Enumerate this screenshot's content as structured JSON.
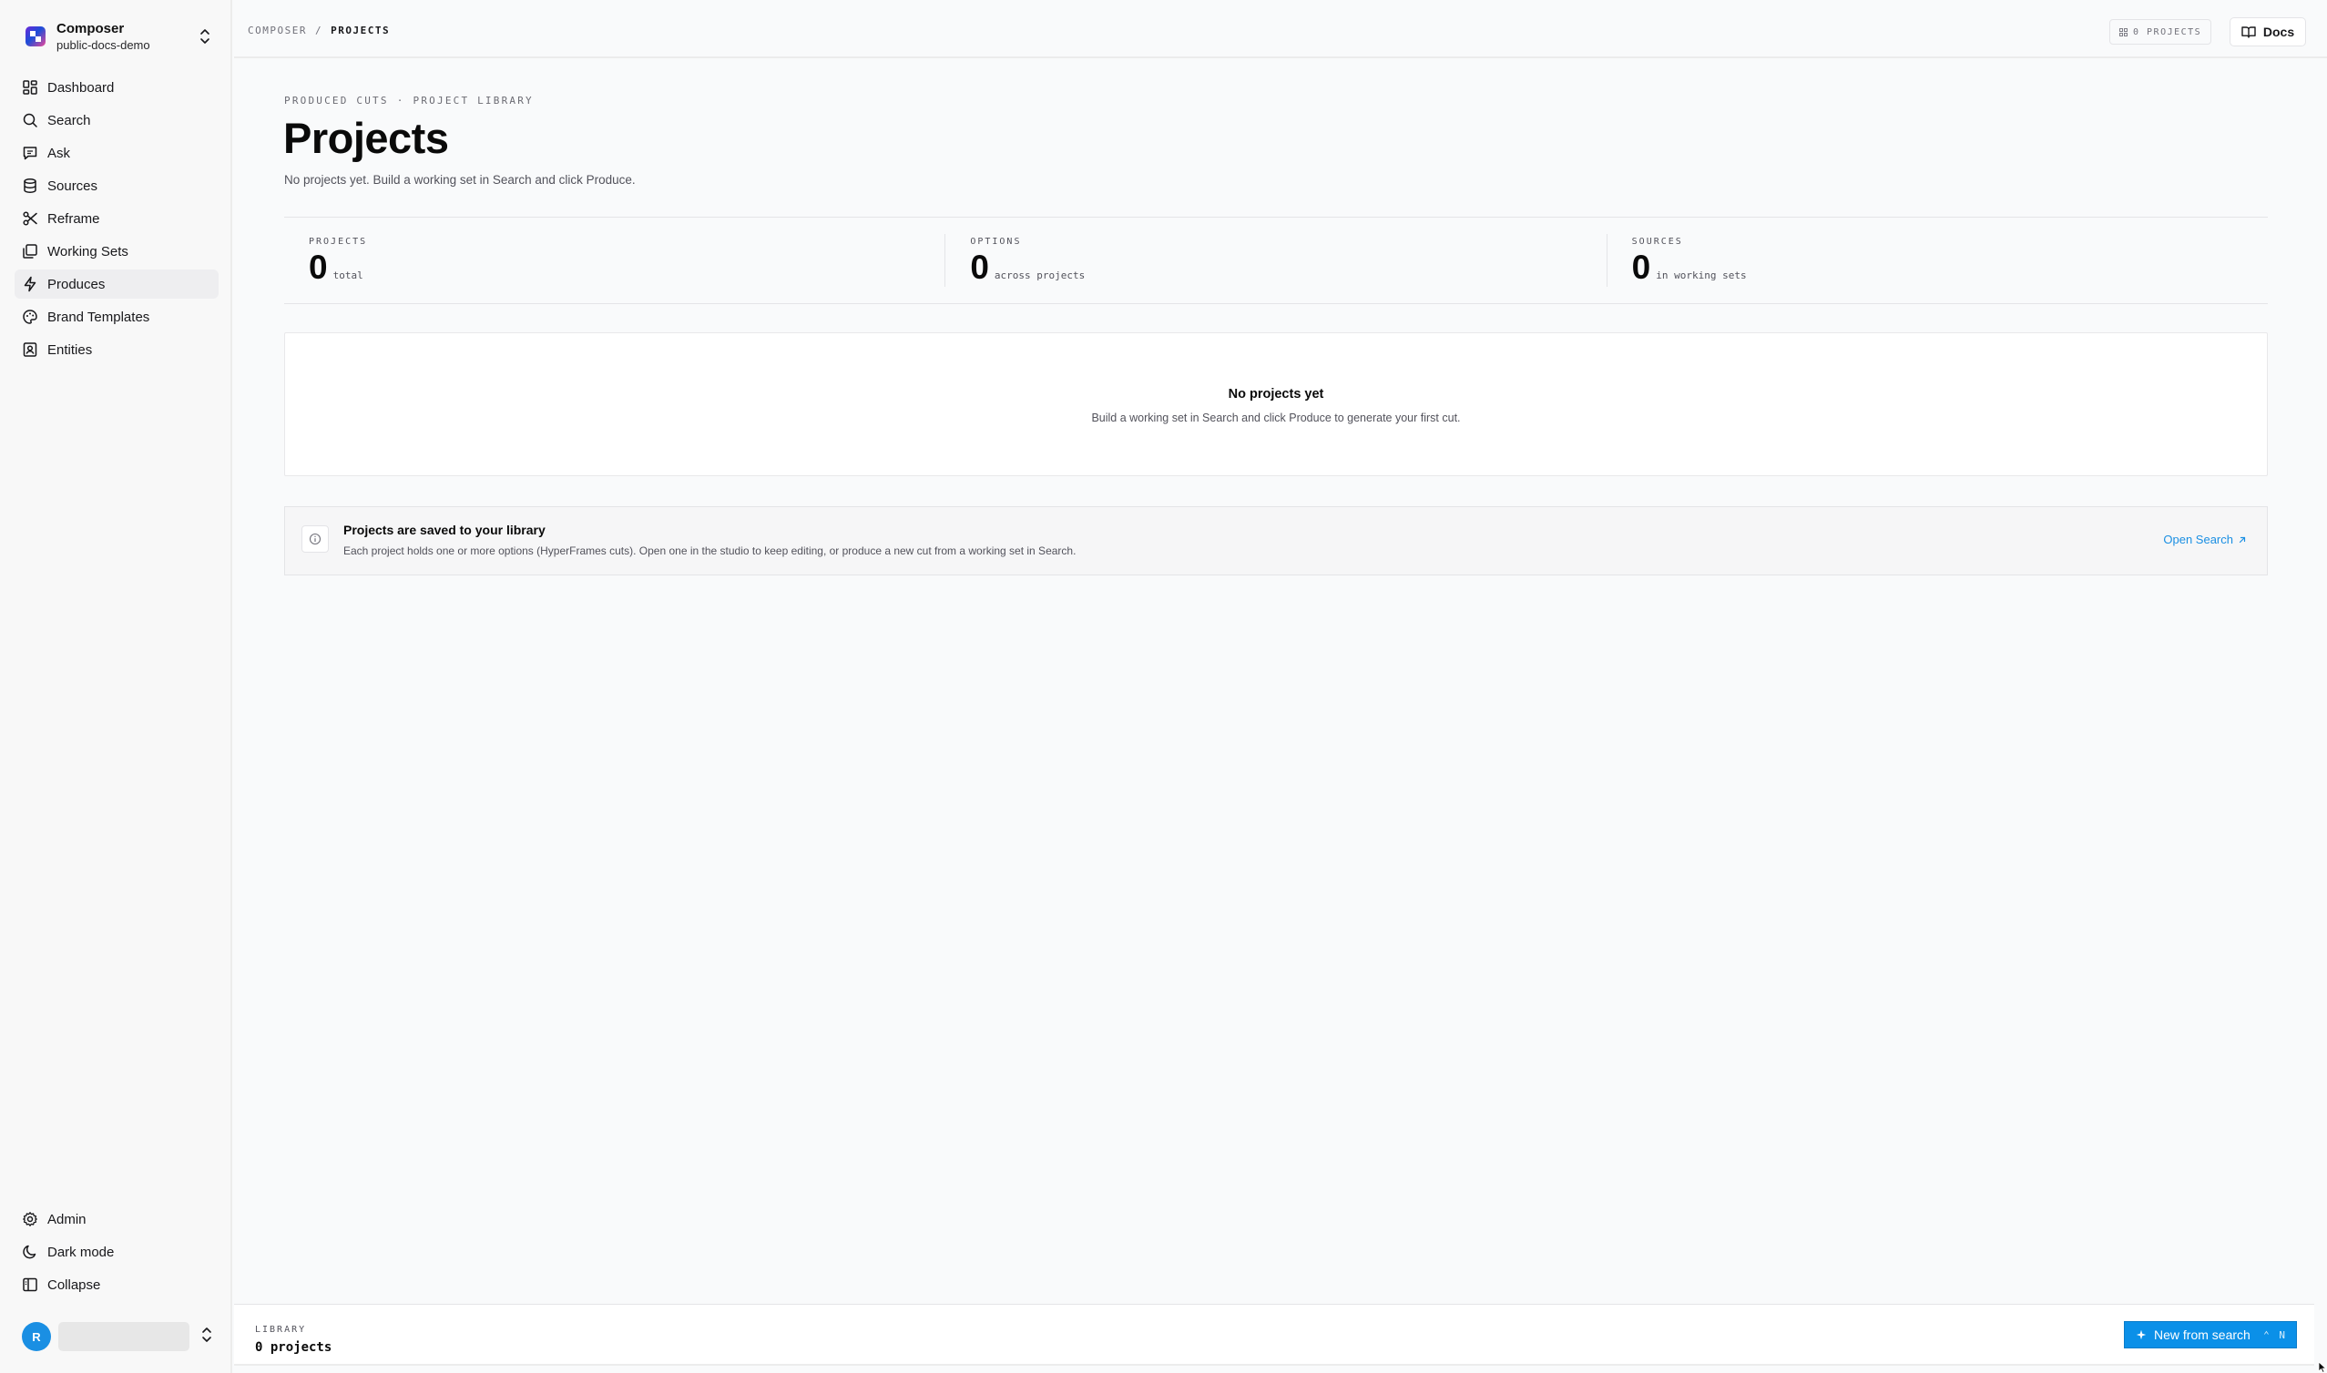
{
  "workspace": {
    "name": "Composer",
    "project": "public-docs-demo"
  },
  "sidebar": {
    "items": [
      {
        "label": "Dashboard",
        "icon": "dashboard-icon"
      },
      {
        "label": "Search",
        "icon": "search-icon"
      },
      {
        "label": "Ask",
        "icon": "chat-icon"
      },
      {
        "label": "Sources",
        "icon": "database-icon"
      },
      {
        "label": "Reframe",
        "icon": "scissors-icon"
      },
      {
        "label": "Working Sets",
        "icon": "stack-icon"
      },
      {
        "label": "Produces",
        "icon": "bolt-icon",
        "active": true
      },
      {
        "label": "Brand Templates",
        "icon": "palette-icon"
      },
      {
        "label": "Entities",
        "icon": "contact-icon"
      }
    ],
    "bottom_items": [
      {
        "label": "Admin",
        "icon": "gear-icon"
      },
      {
        "label": "Dark mode",
        "icon": "moon-icon"
      },
      {
        "label": "Collapse",
        "icon": "sidebar-collapse-icon"
      }
    ],
    "user_initial": "R"
  },
  "topbar": {
    "breadcrumb_root": "COMPOSER",
    "breadcrumb_sep": "/",
    "breadcrumb_current": "PROJECTS",
    "projects_chip": "0 PROJECTS",
    "docs_label": "Docs"
  },
  "main": {
    "eyebrow_a": "PRODUCED CUTS",
    "eyebrow_dot": "·",
    "eyebrow_b": "PROJECT LIBRARY",
    "title": "Projects",
    "subtitle": "No projects yet. Build a working set in Search and click Produce.",
    "stats": [
      {
        "label": "PROJECTS",
        "value": "0",
        "unit": "total"
      },
      {
        "label": "OPTIONS",
        "value": "0",
        "unit": "across projects"
      },
      {
        "label": "SOURCES",
        "value": "0",
        "unit": "in working sets"
      }
    ],
    "empty_state": {
      "title": "No projects yet",
      "text": "Build a working set in Search and click Produce to generate your first cut."
    },
    "info": {
      "title": "Projects are saved to your library",
      "text": "Each project holds one or more options (HyperFrames cuts). Open one in the studio to keep editing, or produce a new cut from a working set in Search.",
      "link": "Open Search"
    }
  },
  "footer": {
    "library_label": "LIBRARY",
    "library_count": "0 projects",
    "new_button": "New from search",
    "shortcut": "⌃ N"
  },
  "colors": {
    "accent": "#0b90e8",
    "link": "#1a8fe3",
    "sidebar_bg": "#f8f8f8",
    "page_bg": "#f9fafb"
  }
}
